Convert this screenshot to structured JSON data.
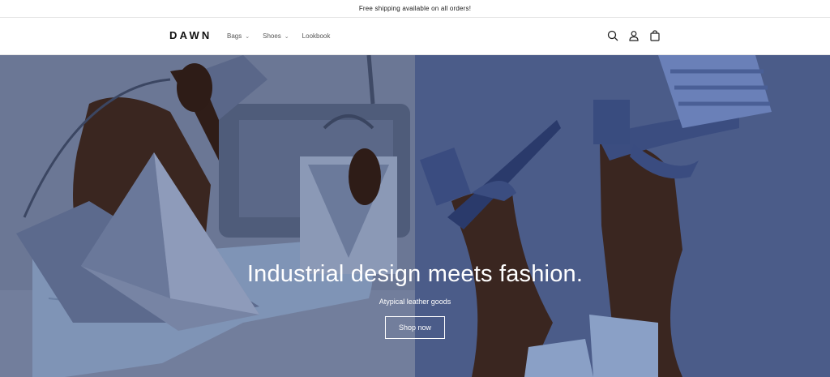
{
  "announcement": "Free shipping available on all orders!",
  "header": {
    "logo": "DAWN",
    "nav": [
      {
        "label": "Bags",
        "has_dropdown": true
      },
      {
        "label": "Shoes",
        "has_dropdown": true
      },
      {
        "label": "Lookbook",
        "has_dropdown": false
      }
    ],
    "icons": [
      "search-icon",
      "account-icon",
      "cart-icon"
    ]
  },
  "hero": {
    "title": "Industrial design meets fashion.",
    "subtitle": "Atypical leather goods",
    "button_label": "Shop now"
  },
  "colors": {
    "left_panel": "#647091",
    "right_panel": "#4a5b88",
    "text_on_hero": "#ffffff"
  }
}
